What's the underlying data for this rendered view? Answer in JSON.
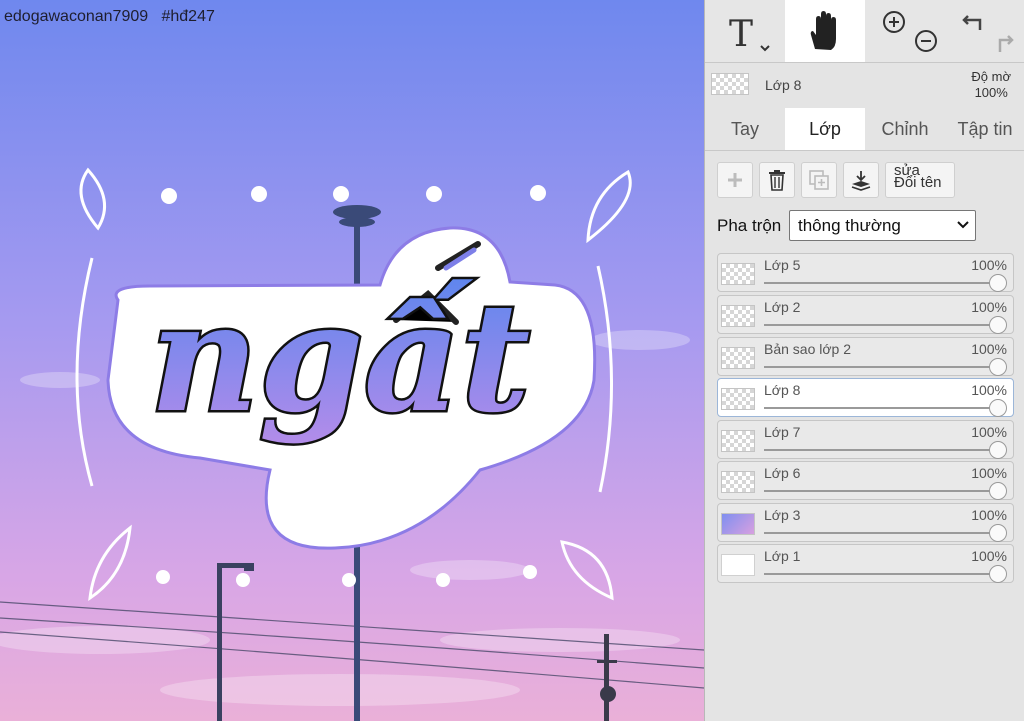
{
  "canvas": {
    "watermark": "edogawaconan7909   #hđ247",
    "sticker_text": "ngất"
  },
  "colors": {
    "sky_top": "#6f88ee",
    "sky_bottom": "#e6a9dc",
    "letter_top": "#5b86ee",
    "letter_bottom": "#b48cea",
    "panel_bg": "#e4e4e4",
    "selected_border": "#9cb6d8"
  },
  "toolbar": {
    "tools": [
      {
        "name": "text-tool",
        "icon": "text-icon"
      },
      {
        "name": "hand-tool",
        "icon": "hand-icon",
        "active": true
      },
      {
        "name": "zoom-tool",
        "icon": "zoom-in-out-icon"
      },
      {
        "name": "undo-redo",
        "icon": "undo-redo-icon"
      }
    ]
  },
  "current_layer": {
    "name": "Lớp 8",
    "opacity_label": "Độ mờ",
    "opacity_value": "100%"
  },
  "tabs": [
    {
      "label": "Tay"
    },
    {
      "label": "Lớp",
      "active": true
    },
    {
      "label": "Chỉnh"
    },
    {
      "label": "Tập tin"
    }
  ],
  "actions": {
    "rename_line1": "sửa",
    "rename_line2": "Đổi tên"
  },
  "blend": {
    "label": "Pha trộn",
    "value": "thông thường"
  },
  "layers": [
    {
      "name": "Lớp 5",
      "opacity": "100%"
    },
    {
      "name": "Lớp 2",
      "opacity": "100%"
    },
    {
      "name": "Bản sao lớp 2",
      "opacity": "100%"
    },
    {
      "name": "Lớp 8",
      "opacity": "100%",
      "selected": true
    },
    {
      "name": "Lớp 7",
      "opacity": "100%"
    },
    {
      "name": "Lớp 6",
      "opacity": "100%"
    },
    {
      "name": "Lớp 3",
      "opacity": "100%"
    },
    {
      "name": "Lớp 1",
      "opacity": "100%"
    }
  ]
}
